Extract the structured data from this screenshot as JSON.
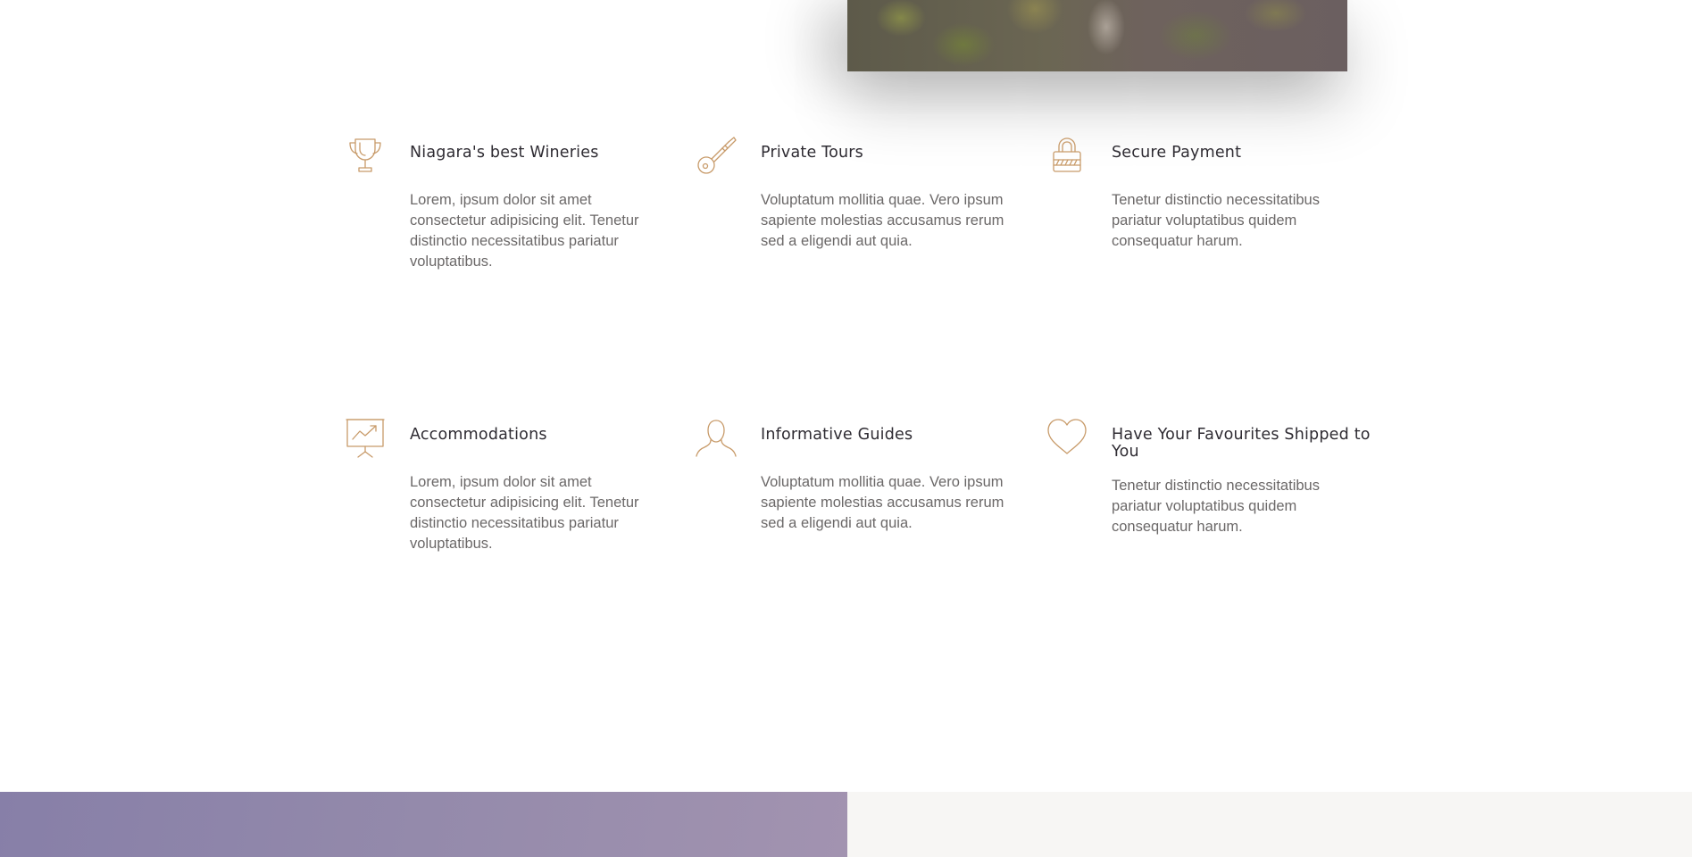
{
  "features": [
    {
      "icon": "trophy-icon",
      "title": "Niagara's best Wineries",
      "text": "Lorem, ipsum dolor sit amet consectetur adipisicing elit. Tenetur distinctio necessitatibus pariatur voluptatibus."
    },
    {
      "icon": "key-icon",
      "title": "Private Tours",
      "text": "Voluptatum mollitia quae. Vero ipsum sapiente molestias accusamus rerum sed a eligendi aut quia."
    },
    {
      "icon": "padlock-icon",
      "title": "Secure Payment",
      "text": "Tenetur distinctio necessitatibus pariatur voluptatibus quidem consequatur harum."
    },
    {
      "icon": "presentation-board-icon",
      "title": "Accommodations",
      "text": "Lorem, ipsum dolor sit amet consectetur adipisicing elit. Tenetur distinctio necessitatibus pariatur voluptatibus."
    },
    {
      "icon": "person-icon",
      "title": "Informative Guides",
      "text": "Voluptatum mollitia quae. Vero ipsum sapiente molestias accusamus rerum sed a eligendi aut quia."
    },
    {
      "icon": "heart-icon",
      "title": "Have Your Favourites Shipped to You",
      "text": "Tenetur distinctio necessitatibus pariatur voluptatibus quidem consequatur harum."
    }
  ],
  "colors": {
    "icon_accent": "#c89b6a",
    "heading": "#2f2c33",
    "body_text": "#6b6868",
    "bottom_left_gradient_start": "#877fa8",
    "bottom_left_gradient_end": "#a293b0",
    "bottom_right_bg": "#f7f6f4"
  }
}
